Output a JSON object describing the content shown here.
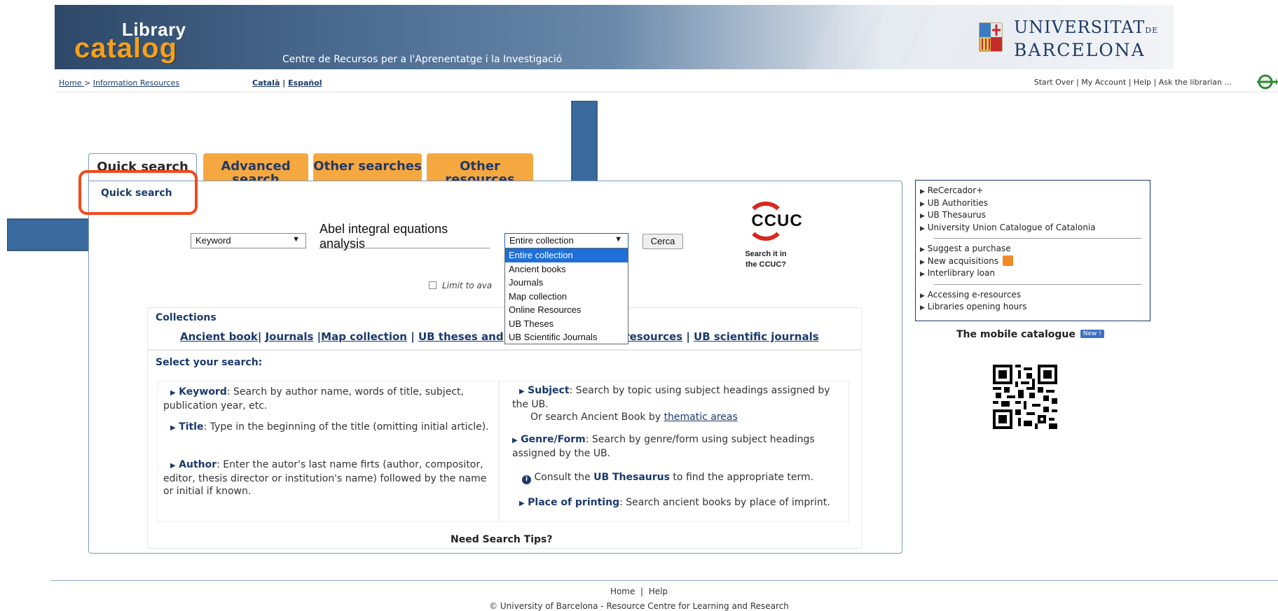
{
  "header": {
    "logo_top": "Library",
    "logo_bottom": "catalog",
    "subtitle": "Centre de Recursos per a l'Aprenentatge i la Investigació",
    "ub_line1": "UNIVERSITAT",
    "ub_line1_small": "DE",
    "ub_line2": "BARCELONA"
  },
  "nav": {
    "home": "Home ",
    "sep": " > ",
    "information_resources": "Information Resources",
    "catala": "Català",
    "lang_sep": " | ",
    "espanol": "Español",
    "start_over": "Start Over",
    "my_account": "My Account",
    "help": "Help",
    "ask": "Ask the librarian ...",
    "pipe": " | "
  },
  "tabs": {
    "quick": "Quick search",
    "advanced": "Advanced search",
    "other_searches": "Other searches",
    "other_resources": "Other resources"
  },
  "quick_search_label": "Quick search",
  "search": {
    "type_value": "Keyword",
    "query": "Abel integral equations analysis",
    "collection_value": "Entire collection",
    "button": "Cerca",
    "limit_label": "Limit to ava",
    "collection_options": [
      "Entire collection",
      "Ancient books",
      "Journals",
      "Map collection",
      "Online Resources",
      "UB Theses",
      "UB Scientific Journals"
    ]
  },
  "ccuc": {
    "logo": "CCUC",
    "caption1": "Search it in",
    "caption2": "the CCUC?"
  },
  "collections": {
    "heading": "Collections",
    "ancient": "Ancient book",
    "journals": "Journals",
    "map": "Map collection",
    "theses": "UB theses and",
    "online": "e resources",
    "scientific": "UB scientific journals"
  },
  "select_search": {
    "heading": "Select your search:",
    "keyword_title": "Keyword",
    "keyword_desc": ": Search by author name, words of title, subject, publication year, etc.",
    "title_title": "Title",
    "title_desc": ": Type in the beginning of the title (omitting initial article).",
    "author_title": "Author",
    "author_desc": ": Enter the autor's last name firts (author, compositor, editor, thesis director or institution's name) followed by the name or initial if known.",
    "subject_title": "Subject",
    "subject_desc": ": Search by topic using subject headings assigned by the UB.",
    "subject_or": "Or search  Ancient Book by ",
    "thematic": "thematic areas",
    "genre_title": "Genre/Form",
    "genre_desc": ": Search by genre/form using subject headings assigned by the UB.",
    "consult_pre": "Consult the ",
    "consult_link": "UB Thesaurus",
    "consult_post": " to find the appropriate term.",
    "place_title": "Place of printing",
    "place_desc": ": Search ancient books by place of imprint.",
    "tips": "Need Search Tips?"
  },
  "sidebar": {
    "group1": [
      "ReCercador+",
      "UB Authorities",
      "UB Thesaurus",
      "University Union Catalogue of Catalonia"
    ],
    "group2": [
      "Suggest a purchase",
      "New acquisitions",
      "Interlibrary loan"
    ],
    "group3": [
      "Accessing e-resources",
      "Libraries opening hours"
    ],
    "mobile": "The mobile catalogue",
    "new_badge": "New !"
  },
  "footer": {
    "home": "Home",
    "sep": "  |  ",
    "help": "Help",
    "copyright": "© University of Barcelona - Resource Centre for Learning and Research"
  },
  "colors": {
    "accent_orange": "#f6a840",
    "brand_navy": "#1a3a6b",
    "highlight_red": "#f04a1c",
    "annotation_arrow": "#3a6a9e"
  }
}
